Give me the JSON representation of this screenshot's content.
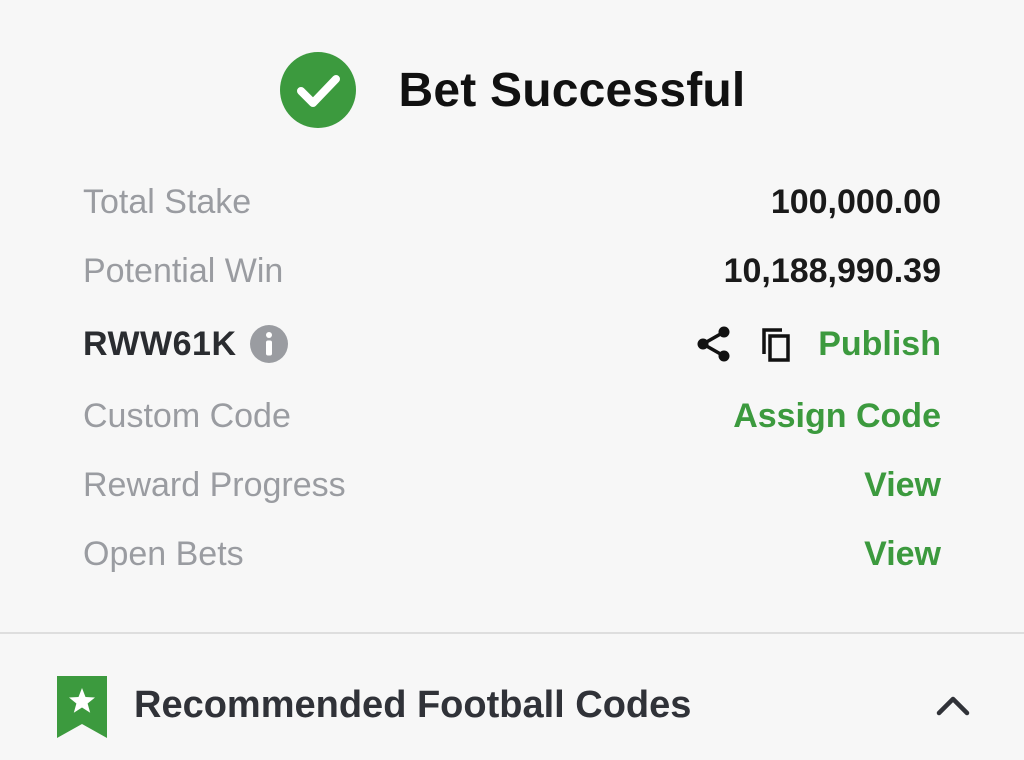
{
  "header": {
    "title": "Bet Successful",
    "icon": "check-circle-icon",
    "icon_color": "#3c9a3e"
  },
  "summary": {
    "total_stake_label": "Total Stake",
    "total_stake_value": "100,000.00",
    "potential_win_label": "Potential Win",
    "potential_win_value": "10,188,990.39",
    "booking_code": "RWW61K",
    "publish_label": "Publish",
    "custom_code_label": "Custom Code",
    "assign_code_label": "Assign Code",
    "reward_progress_label": "Reward Progress",
    "reward_progress_link": "View",
    "open_bets_label": "Open Bets",
    "open_bets_link": "View"
  },
  "recommended": {
    "title": "Recommended Football Codes",
    "icon": "bookmark-star-icon"
  },
  "colors": {
    "accent_green": "#3c9a3e",
    "label_gray": "#9a9ca1",
    "background": "#f7f7f7"
  }
}
